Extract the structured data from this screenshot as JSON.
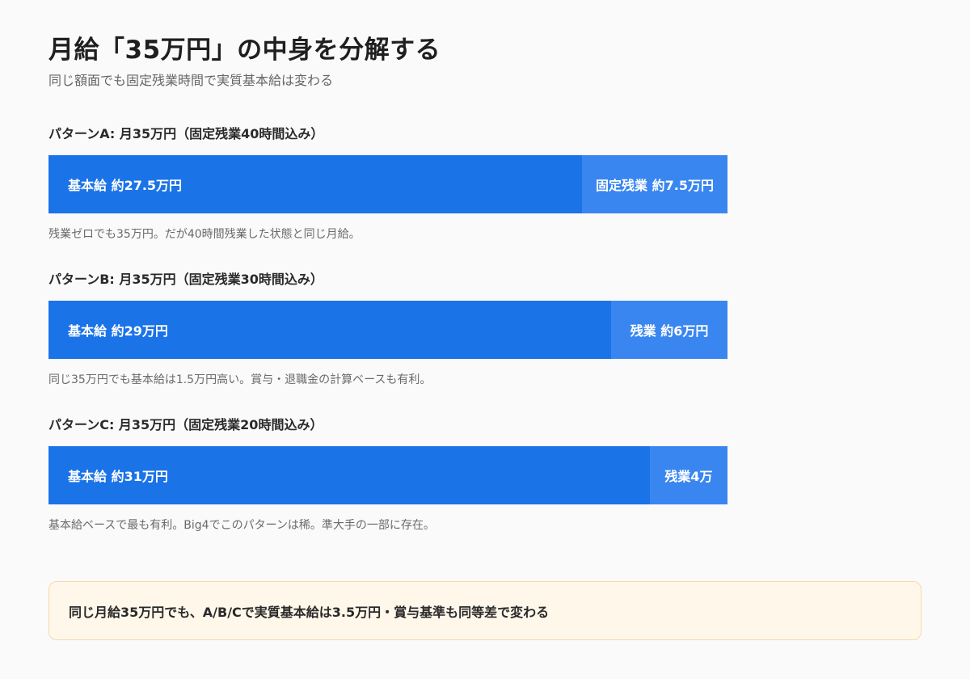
{
  "title": "月給「35万円」の中身を分解する",
  "subtitle": "同じ額面でも固定残業時間で実質基本給は変わる",
  "patterns": [
    {
      "label": "パターンA: 月35万円（固定残業40時間込み）",
      "base_label": "基本給 約27.5万円",
      "base_value": 27.5,
      "ot_label": "固定残業 約7.5万円",
      "ot_value": 7.5,
      "note": "残業ゼロでも35万円。だが40時間残業した状態と同じ月給。"
    },
    {
      "label": "パターンB: 月35万円（固定残業30時間込み）",
      "base_label": "基本給 約29万円",
      "base_value": 29,
      "ot_label": "残業 約6万円",
      "ot_value": 6,
      "note": "同じ35万円でも基本給は1.5万円高い。賞与・退職金の計算ベースも有利。"
    },
    {
      "label": "パターンC: 月35万円（固定残業20時間込み）",
      "base_label": "基本給 約31万円",
      "base_value": 31,
      "ot_label": "残業4万",
      "ot_value": 4,
      "note": "基本給ベースで最も有利。Big4でこのパターンは稀。準大手の一部に存在。"
    }
  ],
  "summary": "同じ月給35万円でも、A/B/Cで実質基本給は3.5万円・賞与基準も同等差で変わる",
  "colors": {
    "base": "#1b73e8",
    "overtime": "#3a86f0",
    "summary_bg": "#fff7ea",
    "summary_border": "#f6d9a8"
  }
}
